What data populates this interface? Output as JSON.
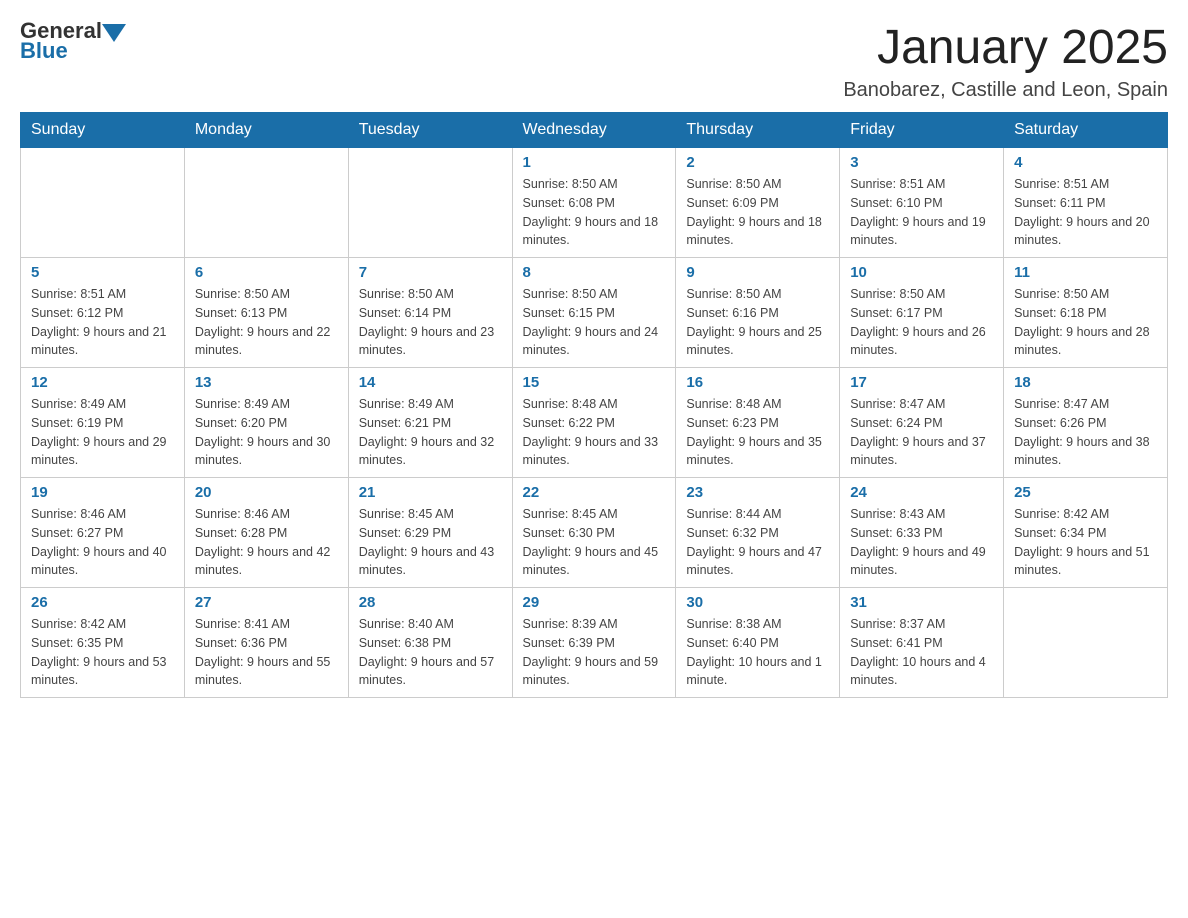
{
  "header": {
    "logo_general": "General",
    "logo_blue": "Blue",
    "title": "January 2025",
    "subtitle": "Banobarez, Castille and Leon, Spain"
  },
  "days_of_week": [
    "Sunday",
    "Monday",
    "Tuesday",
    "Wednesday",
    "Thursday",
    "Friday",
    "Saturday"
  ],
  "weeks": [
    [
      {
        "day": "",
        "info": ""
      },
      {
        "day": "",
        "info": ""
      },
      {
        "day": "",
        "info": ""
      },
      {
        "day": "1",
        "info": "Sunrise: 8:50 AM\nSunset: 6:08 PM\nDaylight: 9 hours and 18 minutes."
      },
      {
        "day": "2",
        "info": "Sunrise: 8:50 AM\nSunset: 6:09 PM\nDaylight: 9 hours and 18 minutes."
      },
      {
        "day": "3",
        "info": "Sunrise: 8:51 AM\nSunset: 6:10 PM\nDaylight: 9 hours and 19 minutes."
      },
      {
        "day": "4",
        "info": "Sunrise: 8:51 AM\nSunset: 6:11 PM\nDaylight: 9 hours and 20 minutes."
      }
    ],
    [
      {
        "day": "5",
        "info": "Sunrise: 8:51 AM\nSunset: 6:12 PM\nDaylight: 9 hours and 21 minutes."
      },
      {
        "day": "6",
        "info": "Sunrise: 8:50 AM\nSunset: 6:13 PM\nDaylight: 9 hours and 22 minutes."
      },
      {
        "day": "7",
        "info": "Sunrise: 8:50 AM\nSunset: 6:14 PM\nDaylight: 9 hours and 23 minutes."
      },
      {
        "day": "8",
        "info": "Sunrise: 8:50 AM\nSunset: 6:15 PM\nDaylight: 9 hours and 24 minutes."
      },
      {
        "day": "9",
        "info": "Sunrise: 8:50 AM\nSunset: 6:16 PM\nDaylight: 9 hours and 25 minutes."
      },
      {
        "day": "10",
        "info": "Sunrise: 8:50 AM\nSunset: 6:17 PM\nDaylight: 9 hours and 26 minutes."
      },
      {
        "day": "11",
        "info": "Sunrise: 8:50 AM\nSunset: 6:18 PM\nDaylight: 9 hours and 28 minutes."
      }
    ],
    [
      {
        "day": "12",
        "info": "Sunrise: 8:49 AM\nSunset: 6:19 PM\nDaylight: 9 hours and 29 minutes."
      },
      {
        "day": "13",
        "info": "Sunrise: 8:49 AM\nSunset: 6:20 PM\nDaylight: 9 hours and 30 minutes."
      },
      {
        "day": "14",
        "info": "Sunrise: 8:49 AM\nSunset: 6:21 PM\nDaylight: 9 hours and 32 minutes."
      },
      {
        "day": "15",
        "info": "Sunrise: 8:48 AM\nSunset: 6:22 PM\nDaylight: 9 hours and 33 minutes."
      },
      {
        "day": "16",
        "info": "Sunrise: 8:48 AM\nSunset: 6:23 PM\nDaylight: 9 hours and 35 minutes."
      },
      {
        "day": "17",
        "info": "Sunrise: 8:47 AM\nSunset: 6:24 PM\nDaylight: 9 hours and 37 minutes."
      },
      {
        "day": "18",
        "info": "Sunrise: 8:47 AM\nSunset: 6:26 PM\nDaylight: 9 hours and 38 minutes."
      }
    ],
    [
      {
        "day": "19",
        "info": "Sunrise: 8:46 AM\nSunset: 6:27 PM\nDaylight: 9 hours and 40 minutes."
      },
      {
        "day": "20",
        "info": "Sunrise: 8:46 AM\nSunset: 6:28 PM\nDaylight: 9 hours and 42 minutes."
      },
      {
        "day": "21",
        "info": "Sunrise: 8:45 AM\nSunset: 6:29 PM\nDaylight: 9 hours and 43 minutes."
      },
      {
        "day": "22",
        "info": "Sunrise: 8:45 AM\nSunset: 6:30 PM\nDaylight: 9 hours and 45 minutes."
      },
      {
        "day": "23",
        "info": "Sunrise: 8:44 AM\nSunset: 6:32 PM\nDaylight: 9 hours and 47 minutes."
      },
      {
        "day": "24",
        "info": "Sunrise: 8:43 AM\nSunset: 6:33 PM\nDaylight: 9 hours and 49 minutes."
      },
      {
        "day": "25",
        "info": "Sunrise: 8:42 AM\nSunset: 6:34 PM\nDaylight: 9 hours and 51 minutes."
      }
    ],
    [
      {
        "day": "26",
        "info": "Sunrise: 8:42 AM\nSunset: 6:35 PM\nDaylight: 9 hours and 53 minutes."
      },
      {
        "day": "27",
        "info": "Sunrise: 8:41 AM\nSunset: 6:36 PM\nDaylight: 9 hours and 55 minutes."
      },
      {
        "day": "28",
        "info": "Sunrise: 8:40 AM\nSunset: 6:38 PM\nDaylight: 9 hours and 57 minutes."
      },
      {
        "day": "29",
        "info": "Sunrise: 8:39 AM\nSunset: 6:39 PM\nDaylight: 9 hours and 59 minutes."
      },
      {
        "day": "30",
        "info": "Sunrise: 8:38 AM\nSunset: 6:40 PM\nDaylight: 10 hours and 1 minute."
      },
      {
        "day": "31",
        "info": "Sunrise: 8:37 AM\nSunset: 6:41 PM\nDaylight: 10 hours and 4 minutes."
      },
      {
        "day": "",
        "info": ""
      }
    ]
  ]
}
